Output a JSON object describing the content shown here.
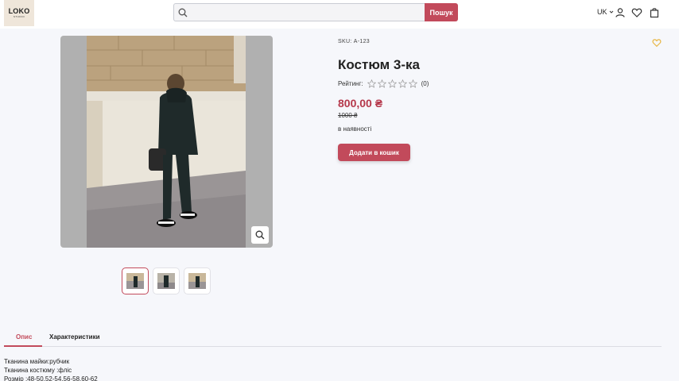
{
  "header": {
    "logo_main": "LOKO",
    "logo_sub": "STUDIO",
    "search_placeholder": "",
    "search_button": "Пошук",
    "lang": "UK"
  },
  "gallery": {
    "thumbnails": 3,
    "active_thumbnail": 1
  },
  "product": {
    "sku": "SKU: А-123",
    "title": "Костюм 3-ка",
    "rating_label": "Рейтинг:",
    "rating_value": 0,
    "rating_count": "(0)",
    "price": "800,00 ₴",
    "old_price": "1000 ₴",
    "stock": "в наявності",
    "add_to_cart": "Додати в кошик"
  },
  "tabs": [
    {
      "label": "Опис",
      "active": true
    },
    {
      "label": "Характеристики",
      "active": false
    }
  ],
  "description": [
    "Тканина майки:рубчик",
    "Тканина костюму :фліс",
    "Розмір :48-50,52-54,56-58,60-62"
  ],
  "colors": {
    "accent": "#c24a5b",
    "price": "#b5384b",
    "favorite": "#e8b84a"
  }
}
